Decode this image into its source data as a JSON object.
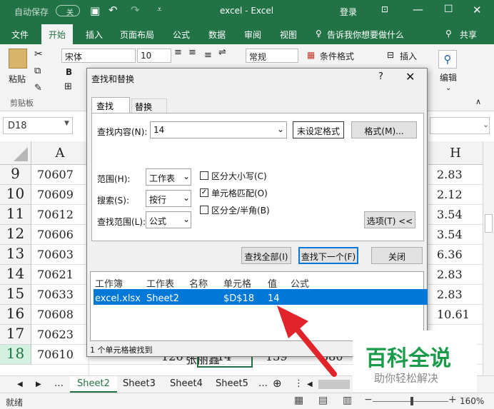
{
  "titlebar": {
    "autosave": "自动保存",
    "autosave_state": "关",
    "title": "excel  -  Excel",
    "login": "登录"
  },
  "tabs": [
    "文件",
    "开始",
    "插入",
    "页面布局",
    "公式",
    "数据",
    "审阅",
    "视图"
  ],
  "tell_me": "告诉我你想要做什么",
  "share": "共享",
  "ribbon": {
    "paste": "粘贴",
    "clipboard": "剪贴板",
    "font_name": "宋体",
    "font_size": "10",
    "number_format": "常规",
    "conditional": "条件格式",
    "insert": "插入",
    "edit": "编辑",
    "bold": "B"
  },
  "namebox": "D18",
  "col_a": "A",
  "col_h": "H",
  "rows": [
    {
      "n": "9",
      "a": "70607",
      "h": "2.83"
    },
    {
      "n": "10",
      "a": "70609",
      "h": "2.12"
    },
    {
      "n": "11",
      "a": "70612",
      "h": "3.54"
    },
    {
      "n": "12",
      "a": "70606",
      "h": "3.54"
    },
    {
      "n": "13",
      "a": "70603",
      "h": "6.36"
    },
    {
      "n": "14",
      "a": "70621",
      "h": "2.83"
    },
    {
      "n": "15",
      "a": "70633",
      "h": "2.83"
    },
    {
      "n": "16",
      "a": "70608",
      "h": "10.61"
    },
    {
      "n": "17",
      "a": "70623",
      "h": ""
    },
    {
      "n": "18",
      "a": "70610",
      "h": ""
    }
  ],
  "row18_extra": {
    "b": "张丽鑫",
    "c": "126",
    "d": "14",
    "e": "139",
    "f": "580"
  },
  "sheets": [
    "Sheet2",
    "Sheet3",
    "Sheet4",
    "Sheet5"
  ],
  "status": {
    "ready": "就绪",
    "zoom": "160%"
  },
  "dialog": {
    "title": "查找和替换",
    "help": "?",
    "tab_find": "查找(D)",
    "tab_replace": "替换(P)",
    "find_label": "查找内容(N):",
    "find_value": "14",
    "no_format": "未设定格式",
    "format_btn": "格式(M)...",
    "scope_label": "范围(H):",
    "scope_value": "工作表",
    "search_label": "搜索(S):",
    "search_value": "按行",
    "lookin_label": "查找范围(L):",
    "lookin_value": "公式",
    "match_case": "区分大小写(C)",
    "match_cell": "单元格匹配(O)",
    "match_width": "区分全/半角(B)",
    "options_btn": "选项(T) <<",
    "find_all": "查找全部(I)",
    "find_next": "查找下一个(F)",
    "close": "关闭",
    "result_headers": [
      "工作簿",
      "工作表",
      "名称",
      "单元格",
      "值",
      "公式"
    ],
    "result_row": [
      "excel.xlsx",
      "Sheet2",
      "",
      "$D$18",
      "14",
      ""
    ],
    "found_text": "1 个单元格被找到"
  },
  "watermark": {
    "title": "百科全说",
    "subtitle": "助你轻松解决"
  },
  "colors": {
    "excel_green": "#217346",
    "selection_blue": "#0078d7",
    "arrow_red": "#e0242a"
  }
}
